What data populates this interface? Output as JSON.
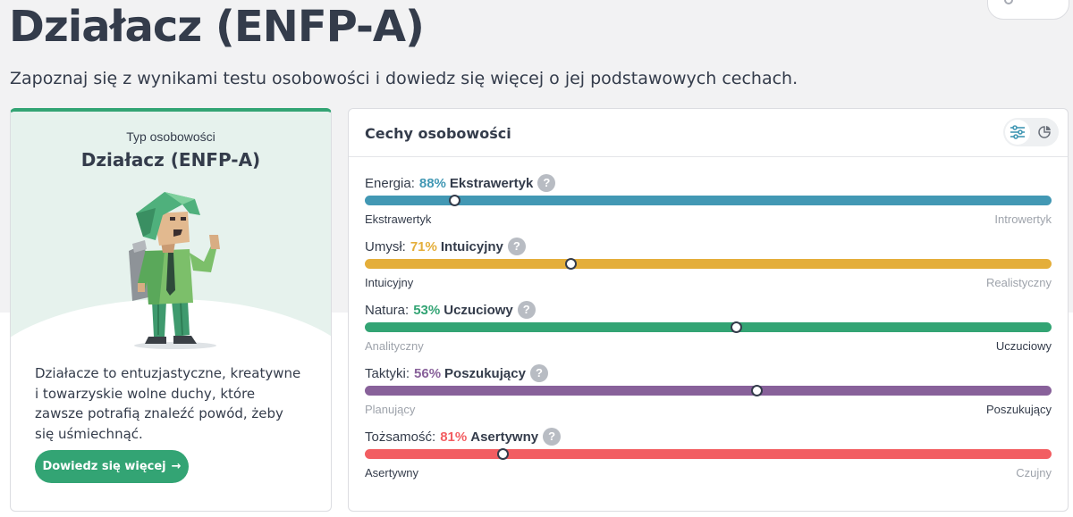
{
  "page": {
    "title": "Działacz (ENFP-A)",
    "subtitle": "Zapoznaj się z wynikami testu osobowości i dowiedz się więcej o jej podstawowych cechach."
  },
  "type_card": {
    "label": "Typ osobowości",
    "name": "Działacz (ENFP-A)",
    "description": "Działacze to entuzjastyczne, kreatywne i towarzyskie wolne duchy, które zawsze potrafią znaleźć powód, żeby się uśmiechnąć.",
    "button_label": "Dowiedz się więcej",
    "button_arrow": "→",
    "accent": "#33a474"
  },
  "traits_card": {
    "title": "Cechy osobowości",
    "icons": [
      "sliders-icon",
      "pie-chart-icon"
    ],
    "traits": [
      {
        "label": "Energia:",
        "percent": "88%",
        "trait": "Ekstrawertyk",
        "help": "?",
        "left_pole": "Ekstrawertyk",
        "right_pole": "Introwertyk",
        "color": "#4298b4",
        "position_pct": 13,
        "active_side": "left"
      },
      {
        "label": "Umysł:",
        "percent": "71%",
        "trait": "Intuicyjny",
        "help": "?",
        "left_pole": "Intuicyjny",
        "right_pole": "Realistyczny",
        "color": "#e4ae3a",
        "position_pct": 30,
        "active_side": "left"
      },
      {
        "label": "Natura:",
        "percent": "53%",
        "trait": "Uczuciowy",
        "help": "?",
        "left_pole": "Analityczny",
        "right_pole": "Uczuciowy",
        "color": "#33a474",
        "position_pct": 54,
        "active_side": "right"
      },
      {
        "label": "Taktyki:",
        "percent": "56%",
        "trait": "Poszukujący",
        "help": "?",
        "left_pole": "Planujący",
        "right_pole": "Poszukujący",
        "color": "#88619a",
        "position_pct": 57,
        "active_side": "right"
      },
      {
        "label": "Tożsamość:",
        "percent": "81%",
        "trait": "Asertywny",
        "help": "?",
        "left_pole": "Asertywny",
        "right_pole": "Czujny",
        "color": "#f25e62",
        "position_pct": 20,
        "active_side": "left"
      }
    ]
  }
}
